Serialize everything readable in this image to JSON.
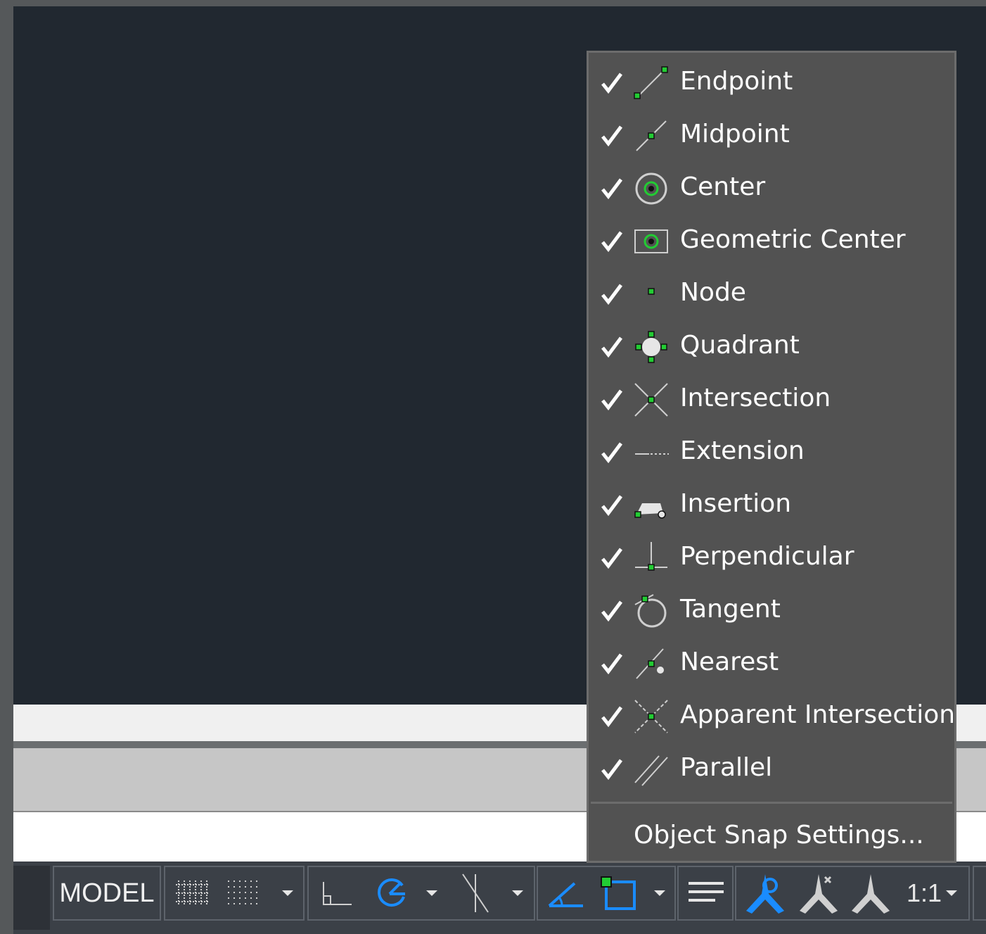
{
  "snap_menu": {
    "items": [
      {
        "label": "Endpoint",
        "checked": true,
        "icon": "endpoint-snap-icon"
      },
      {
        "label": "Midpoint",
        "checked": true,
        "icon": "midpoint-snap-icon"
      },
      {
        "label": "Center",
        "checked": true,
        "icon": "center-snap-icon"
      },
      {
        "label": "Geometric Center",
        "checked": true,
        "icon": "geometric-center-snap-icon"
      },
      {
        "label": "Node",
        "checked": true,
        "icon": "node-snap-icon"
      },
      {
        "label": "Quadrant",
        "checked": true,
        "icon": "quadrant-snap-icon"
      },
      {
        "label": "Intersection",
        "checked": true,
        "icon": "intersection-snap-icon"
      },
      {
        "label": "Extension",
        "checked": true,
        "icon": "extension-snap-icon"
      },
      {
        "label": "Insertion",
        "checked": true,
        "icon": "insertion-snap-icon"
      },
      {
        "label": "Perpendicular",
        "checked": true,
        "icon": "perpendicular-snap-icon"
      },
      {
        "label": "Tangent",
        "checked": true,
        "icon": "tangent-snap-icon"
      },
      {
        "label": "Nearest",
        "checked": true,
        "icon": "nearest-snap-icon"
      },
      {
        "label": "Apparent Intersection",
        "checked": true,
        "icon": "apparent-intersection-snap-icon"
      },
      {
        "label": "Parallel",
        "checked": true,
        "icon": "parallel-snap-icon"
      }
    ],
    "settings_label": "Object Snap Settings..."
  },
  "status_bar": {
    "model_label": "MODEL",
    "annotation_scale": "1:1"
  },
  "colors": {
    "canvas": "#212830",
    "menu_bg": "#525252",
    "snap_green": "#22cc33",
    "active_blue": "#1a8cff"
  }
}
